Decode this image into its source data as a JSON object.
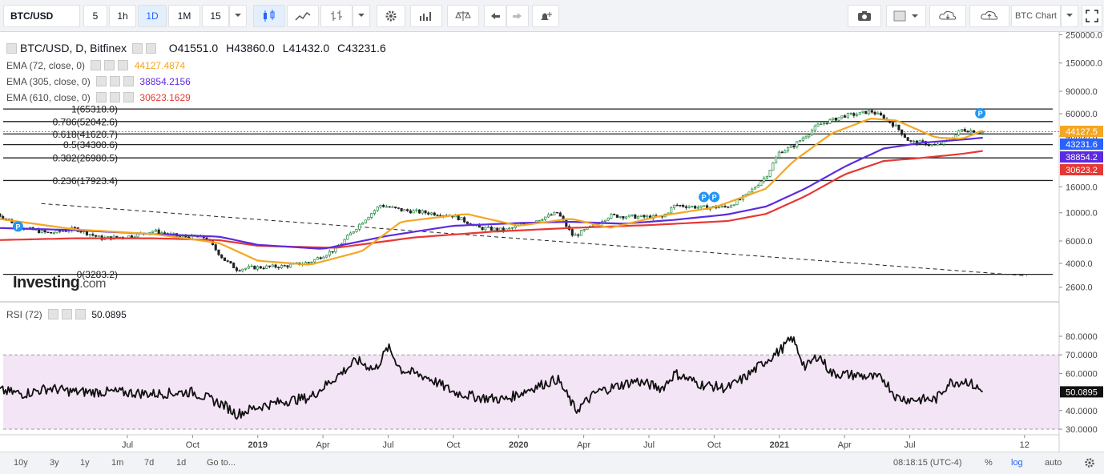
{
  "toolbar": {
    "symbol": "BTC/USD",
    "intervals": [
      "5",
      "1h",
      "1D",
      "1M",
      "15"
    ],
    "active_interval": "1D",
    "chart_label": "BTC Chart"
  },
  "legend": {
    "title": "BTC/USD, D, Bitfinex",
    "open_label": "O",
    "open": "41551.0",
    "high_label": "H",
    "high": "43860.0",
    "low_label": "L",
    "low": "41432.0",
    "close_label": "C",
    "close": "43231.6",
    "ema72_label": "EMA (72, close, 0)",
    "ema72_value": "44127.4874",
    "ema305_label": "EMA (305, close, 0)",
    "ema305_value": "38854.2156",
    "ema610_label": "EMA (610, close, 0)",
    "ema610_value": "30623.1629",
    "rsi_label": "RSI (72)",
    "rsi_value": "50.0895"
  },
  "logo": {
    "main": "Investing",
    "suffix": ".com"
  },
  "bottombar": {
    "ranges": [
      "10y",
      "3y",
      "1y",
      "1m",
      "7d",
      "1d"
    ],
    "goto": "Go to...",
    "time": "08:18:15 (UTC-4)",
    "pct": "%",
    "log": "log",
    "auto": "auto"
  },
  "colors": {
    "ema72": "#f5a623",
    "ema305": "#5b2be0",
    "ema610": "#e53935",
    "rsi_band": "#f3e5f5",
    "up": "#1e8a3e",
    "down": "#222222",
    "tag_blue": "#2196f3"
  },
  "chart_data": {
    "type": "line",
    "x_ticks": [
      "Jul",
      "Oct",
      "2019",
      "Apr",
      "Jul",
      "Oct",
      "2020",
      "Apr",
      "Jul",
      "Oct",
      "2021",
      "Apr",
      "Jul",
      "12"
    ],
    "price_axis": {
      "scale": "log",
      "ticks": [
        "250000.0",
        "150000.0",
        "90000.0",
        "60000.0",
        "40000.0",
        "16000.0",
        "10000.0",
        "6000.0",
        "4000.0",
        "2600.0"
      ]
    },
    "price_tags": [
      {
        "value": "44127.5",
        "series": "EMA (72, close, 0)"
      },
      {
        "value": "43231.6",
        "series": "close"
      },
      {
        "value": "38854.2",
        "series": "EMA (305, close, 0)"
      },
      {
        "value": "30623.2",
        "series": "EMA (610, close, 0)"
      }
    ],
    "fib_levels": [
      {
        "label": "1(65318.0)",
        "value": 65318.0
      },
      {
        "label": "0.786(52042.6)",
        "value": 52042.6
      },
      {
        "label": "0.618(41620.7)",
        "value": 41620.7
      },
      {
        "label": "0.5(34300.6)",
        "value": 34300.6
      },
      {
        "label": "0.382(26980.5)",
        "value": 26980.5
      },
      {
        "label": "0.236(17923.4)",
        "value": 17923.4
      },
      {
        "label": "0(3283.2)",
        "value": 3283.2
      }
    ],
    "trendline": {
      "start": [
        2018.17,
        11800
      ],
      "end": [
        2021.95,
        3200
      ]
    },
    "series_price": {
      "name": "BTC/USD",
      "t": [
        2018.0,
        2018.1,
        2018.2,
        2018.3,
        2018.4,
        2018.5,
        2018.6,
        2018.7,
        2018.8,
        2018.87,
        2018.92,
        2018.97,
        2019.1,
        2019.2,
        2019.3,
        2019.4,
        2019.47,
        2019.55,
        2019.65,
        2019.75,
        2019.85,
        2019.95,
        2020.05,
        2020.15,
        2020.21,
        2020.25,
        2020.35,
        2020.45,
        2020.55,
        2020.6,
        2020.7,
        2020.8,
        2020.87,
        2020.95,
        2021.0,
        2021.05,
        2021.15,
        2021.25,
        2021.3,
        2021.35,
        2021.4,
        2021.45,
        2021.5,
        2021.55,
        2021.6,
        2021.65,
        2021.7,
        2021.78
      ],
      "v": [
        9800,
        7600,
        6900,
        7500,
        6300,
        6500,
        7200,
        6500,
        6400,
        4300,
        3600,
        3700,
        3800,
        4100,
        5200,
        8500,
        11500,
        10500,
        10000,
        9500,
        7600,
        7300,
        8500,
        10000,
        6500,
        7200,
        9500,
        9300,
        9200,
        11500,
        11000,
        11100,
        13500,
        19500,
        30000,
        33000,
        49000,
        58000,
        59500,
        63000,
        56000,
        47000,
        36000,
        35500,
        33500,
        37000,
        45000,
        43200
      ]
    },
    "series_ema72": {
      "name": "EMA (72, close, 0)",
      "t": [
        2018.0,
        2018.3,
        2018.6,
        2018.85,
        2019.0,
        2019.2,
        2019.4,
        2019.55,
        2019.8,
        2020.0,
        2020.2,
        2020.35,
        2020.55,
        2020.75,
        2020.95,
        2021.05,
        2021.2,
        2021.35,
        2021.45,
        2021.6,
        2021.7,
        2021.78
      ],
      "v": [
        9000,
        7400,
        6800,
        5800,
        4200,
        3900,
        5000,
        8500,
        9800,
        7900,
        9000,
        7600,
        9500,
        11000,
        15500,
        25000,
        42000,
        55000,
        53000,
        39000,
        38000,
        44127
      ]
    },
    "series_ema305": {
      "name": "EMA (305, close, 0)",
      "t": [
        2018.0,
        2018.3,
        2018.6,
        2018.85,
        2019.0,
        2019.25,
        2019.5,
        2019.75,
        2020.0,
        2020.2,
        2020.4,
        2020.6,
        2020.8,
        2020.95,
        2021.1,
        2021.25,
        2021.4,
        2021.55,
        2021.7,
        2021.78
      ],
      "v": [
        7600,
        7300,
        6800,
        6500,
        5600,
        5200,
        6600,
        7900,
        8300,
        8500,
        8200,
        8800,
        9700,
        11200,
        15500,
        23000,
        32000,
        35500,
        37500,
        38854
      ]
    },
    "series_ema610": {
      "name": "EMA (610, close, 0)",
      "t": [
        2018.0,
        2018.3,
        2018.6,
        2018.85,
        2019.0,
        2019.3,
        2019.6,
        2019.9,
        2020.2,
        2020.5,
        2020.8,
        2020.95,
        2021.1,
        2021.25,
        2021.4,
        2021.55,
        2021.7,
        2021.78
      ],
      "v": [
        6100,
        6300,
        6300,
        6100,
        5500,
        5300,
        6400,
        7100,
        7600,
        8000,
        8600,
        9800,
        13500,
        20000,
        25500,
        27000,
        29000,
        30623
      ]
    },
    "series_rsi": {
      "name": "RSI (72)",
      "t": [
        2018.0,
        2018.1,
        2018.2,
        2018.3,
        2018.45,
        2018.6,
        2018.75,
        2018.87,
        2018.92,
        2019.0,
        2019.1,
        2019.2,
        2019.3,
        2019.38,
        2019.45,
        2019.5,
        2019.55,
        2019.65,
        2019.75,
        2019.85,
        2019.95,
        2020.05,
        2020.15,
        2020.22,
        2020.3,
        2020.45,
        2020.55,
        2020.6,
        2020.7,
        2020.8,
        2020.87,
        2020.95,
        2021.0,
        2021.05,
        2021.1,
        2021.15,
        2021.2,
        2021.3,
        2021.4,
        2021.45,
        2021.5,
        2021.6,
        2021.65,
        2021.72,
        2021.78
      ],
      "v": [
        51,
        49,
        52,
        50,
        50,
        49,
        50,
        43,
        38,
        42,
        45,
        47,
        58,
        67,
        62,
        74,
        62,
        58,
        50,
        47,
        46,
        52,
        57,
        40,
        50,
        56,
        52,
        60,
        54,
        52,
        58,
        67,
        72,
        79,
        63,
        70,
        60,
        59,
        57,
        47,
        46,
        46,
        55,
        56,
        50
      ]
    }
  }
}
